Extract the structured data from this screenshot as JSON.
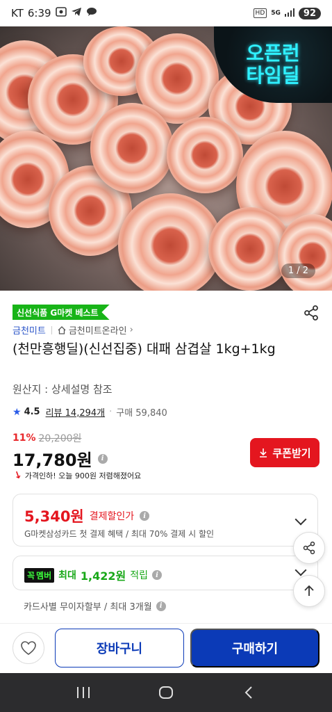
{
  "status_bar": {
    "carrier": "KT",
    "time": "6:39",
    "network_label": "HD",
    "network_type": "5G",
    "battery": "92"
  },
  "hero": {
    "promo_line1": "오픈런",
    "promo_line2": "타임딜",
    "image_counter": "1 / 2"
  },
  "product": {
    "best_tag": "신선식품 G마켓 베스트",
    "seller": "금천미트",
    "store_link": "금천미트온라인",
    "title": "(천만흥행딜)(신선집중) 대패 삼겹살 1kg+1kg",
    "origin": "원산지 : 상세설명 참조",
    "rating": "4.5",
    "review_label": "리뷰 14,294개",
    "purchase_label": "구매 59,840",
    "discount_rate": "11%",
    "original_price": "20,200원",
    "sale_price": "17,780원",
    "coupon_label": "쿠폰받기",
    "price_drop_notice": "가격인하! 오늘 900원 저렴해졌어요"
  },
  "payment_discount": {
    "amount": "5,340원",
    "label": "결제할인가",
    "description": "G마켓삼성카드 첫 결제 혜택 / 최대 70% 결제 시 할인"
  },
  "membership": {
    "badge_text": "멤버",
    "prefix": "최대",
    "amount": "1,422원",
    "suffix": "적립"
  },
  "installment": {
    "text": "카드사별 무이자할부 / 최대 3개월"
  },
  "actions": {
    "cart_label": "장바구니",
    "buy_label": "구매하기"
  },
  "colors": {
    "brand_blue": "#0b3ab7",
    "sale_red": "#e4161f",
    "member_green": "#18a818"
  },
  "icons": [
    "share-icon",
    "home-store-icon",
    "star-icon",
    "info-icon",
    "download-arrow-icon",
    "chevron-down-icon",
    "arrow-up-icon",
    "heart-icon",
    "recents-icon",
    "home-icon",
    "back-icon"
  ]
}
